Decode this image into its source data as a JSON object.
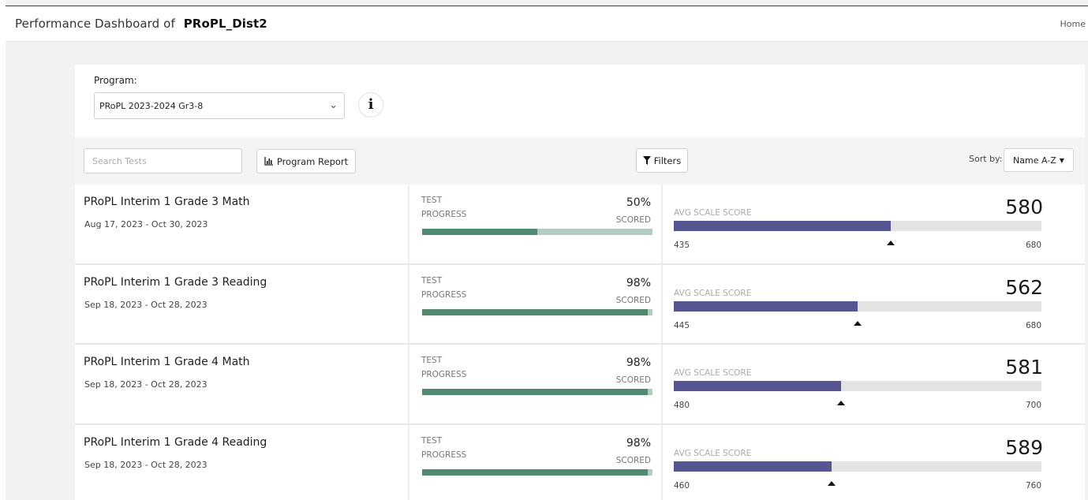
{
  "header": {
    "title_prefix": "Performance Dashboard of",
    "district": "PRoPL_Dist2",
    "home_link": "Home"
  },
  "program": {
    "label": "Program:",
    "selected": "PRoPL 2023-2024 Gr3-8",
    "info_icon": "info-icon"
  },
  "toolbar": {
    "search_placeholder": "Search Tests",
    "program_report_label": "Program Report",
    "filters_label": "Filters",
    "sort_label": "Sort by:",
    "sort_value": "Name A-Z"
  },
  "labels": {
    "test": "TEST",
    "progress": "PROGRESS",
    "scored": "SCORED",
    "avg_scale_score": "AVG SCALE SCORE"
  },
  "colors": {
    "progress_fill": "#4f8a71",
    "progress_track": "#b5ccc3",
    "score_fill": "#555592",
    "score_track": "#e3e3e3"
  },
  "tests": [
    {
      "name": "PRoPL Interim 1 Grade 3 Math",
      "dates": "Aug 17, 2023 - Oct 30, 2023",
      "progress_pct": "50%",
      "progress_value": 0.5,
      "avg_scale_score": "580",
      "score_min": "435",
      "score_max": "680",
      "score_fill_fraction": 0.59
    },
    {
      "name": "PRoPL Interim 1 Grade 3 Reading",
      "dates": "Sep 18, 2023 - Oct 28, 2023",
      "progress_pct": "98%",
      "progress_value": 0.98,
      "avg_scale_score": "562",
      "score_min": "445",
      "score_max": "680",
      "score_fill_fraction": 0.5
    },
    {
      "name": "PRoPL Interim 1 Grade 4 Math",
      "dates": "Sep 18, 2023 - Oct 28, 2023",
      "progress_pct": "98%",
      "progress_value": 0.98,
      "avg_scale_score": "581",
      "score_min": "480",
      "score_max": "700",
      "score_fill_fraction": 0.455
    },
    {
      "name": "PRoPL Interim 1 Grade 4 Reading",
      "dates": "Sep 18, 2023 - Oct 28, 2023",
      "progress_pct": "98%",
      "progress_value": 0.98,
      "avg_scale_score": "589",
      "score_min": "460",
      "score_max": "760",
      "score_fill_fraction": 0.43
    }
  ]
}
